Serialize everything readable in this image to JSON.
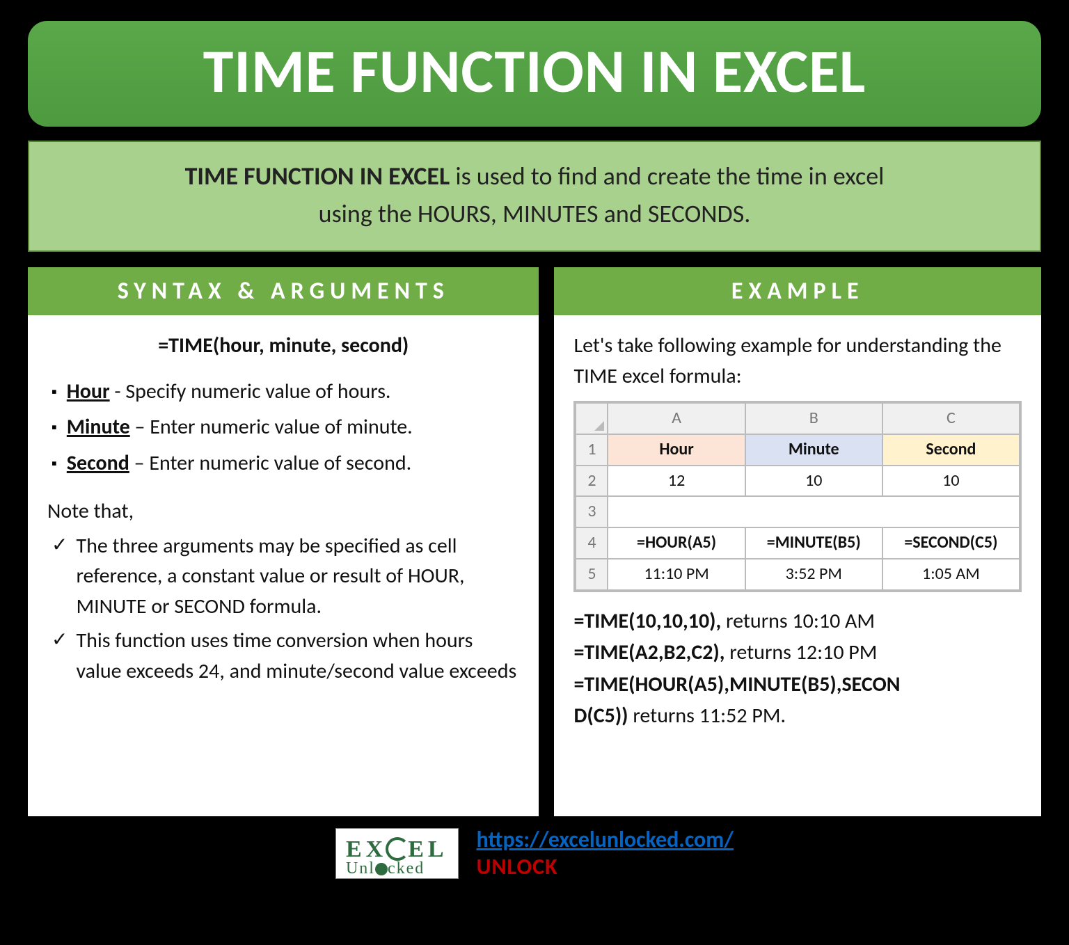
{
  "title": "TIME FUNCTION IN EXCEL",
  "description": {
    "bold": "TIME FUNCTION IN EXCEL",
    "rest1": " is used to find and create the time in excel",
    "rest2": "using the HOURS, MINUTES and SECONDS."
  },
  "syntax": {
    "header": "SYNTAX & ARGUMENTS",
    "formula": "=TIME(hour, minute, second)",
    "args": [
      {
        "name": "Hour",
        "sep": " - ",
        "text": "Specify numeric value of hours."
      },
      {
        "name": "Minute",
        "sep": " – ",
        "text": "Enter numeric value of minute."
      },
      {
        "name": "Second",
        "sep": " – ",
        "text": "Enter numeric value of second."
      }
    ],
    "note_label": "Note that,",
    "notes": [
      "The three arguments may be specified as cell reference, a constant value or result of HOUR, MINUTE or SECOND formula.",
      "This function uses time conversion when hours value exceeds 24, and minute/second value exceeds"
    ]
  },
  "example": {
    "header": "EXAMPLE",
    "intro": "Let's take following example for understanding the TIME excel formula:",
    "grid": {
      "cols": [
        "A",
        "B",
        "C"
      ],
      "row1": {
        "a": "Hour",
        "b": "Minute",
        "c": "Second"
      },
      "row2": {
        "a": "12",
        "b": "10",
        "c": "10"
      },
      "row4": {
        "a": "=HOUR(A5)",
        "b": "=MINUTE(B5)",
        "c": "=SECOND(C5)"
      },
      "row5": {
        "a": "11:10 PM",
        "b": "3:52 PM",
        "c": "1:05 AM"
      },
      "rownums": [
        "1",
        "2",
        "3",
        "4",
        "5"
      ]
    },
    "formulas": [
      {
        "f": "=TIME(10,10,10),",
        "r": " returns 10:10 AM"
      },
      {
        "f": "=TIME(A2,B2,C2),",
        "r": " returns 12:10 PM"
      },
      {
        "f": "=TIME(HOUR(A5),MINUTE(B5),SECON",
        "r": ""
      },
      {
        "f": "D(C5))",
        "r": " returns 11:52 PM."
      }
    ]
  },
  "footer": {
    "url": "https://excelunlocked.com/",
    "unlock": "UNLOCK",
    "logo_row1_a": "EX",
    "logo_row1_b": "EL",
    "logo_row2_a": "Unl",
    "logo_row2_b": "cked"
  }
}
